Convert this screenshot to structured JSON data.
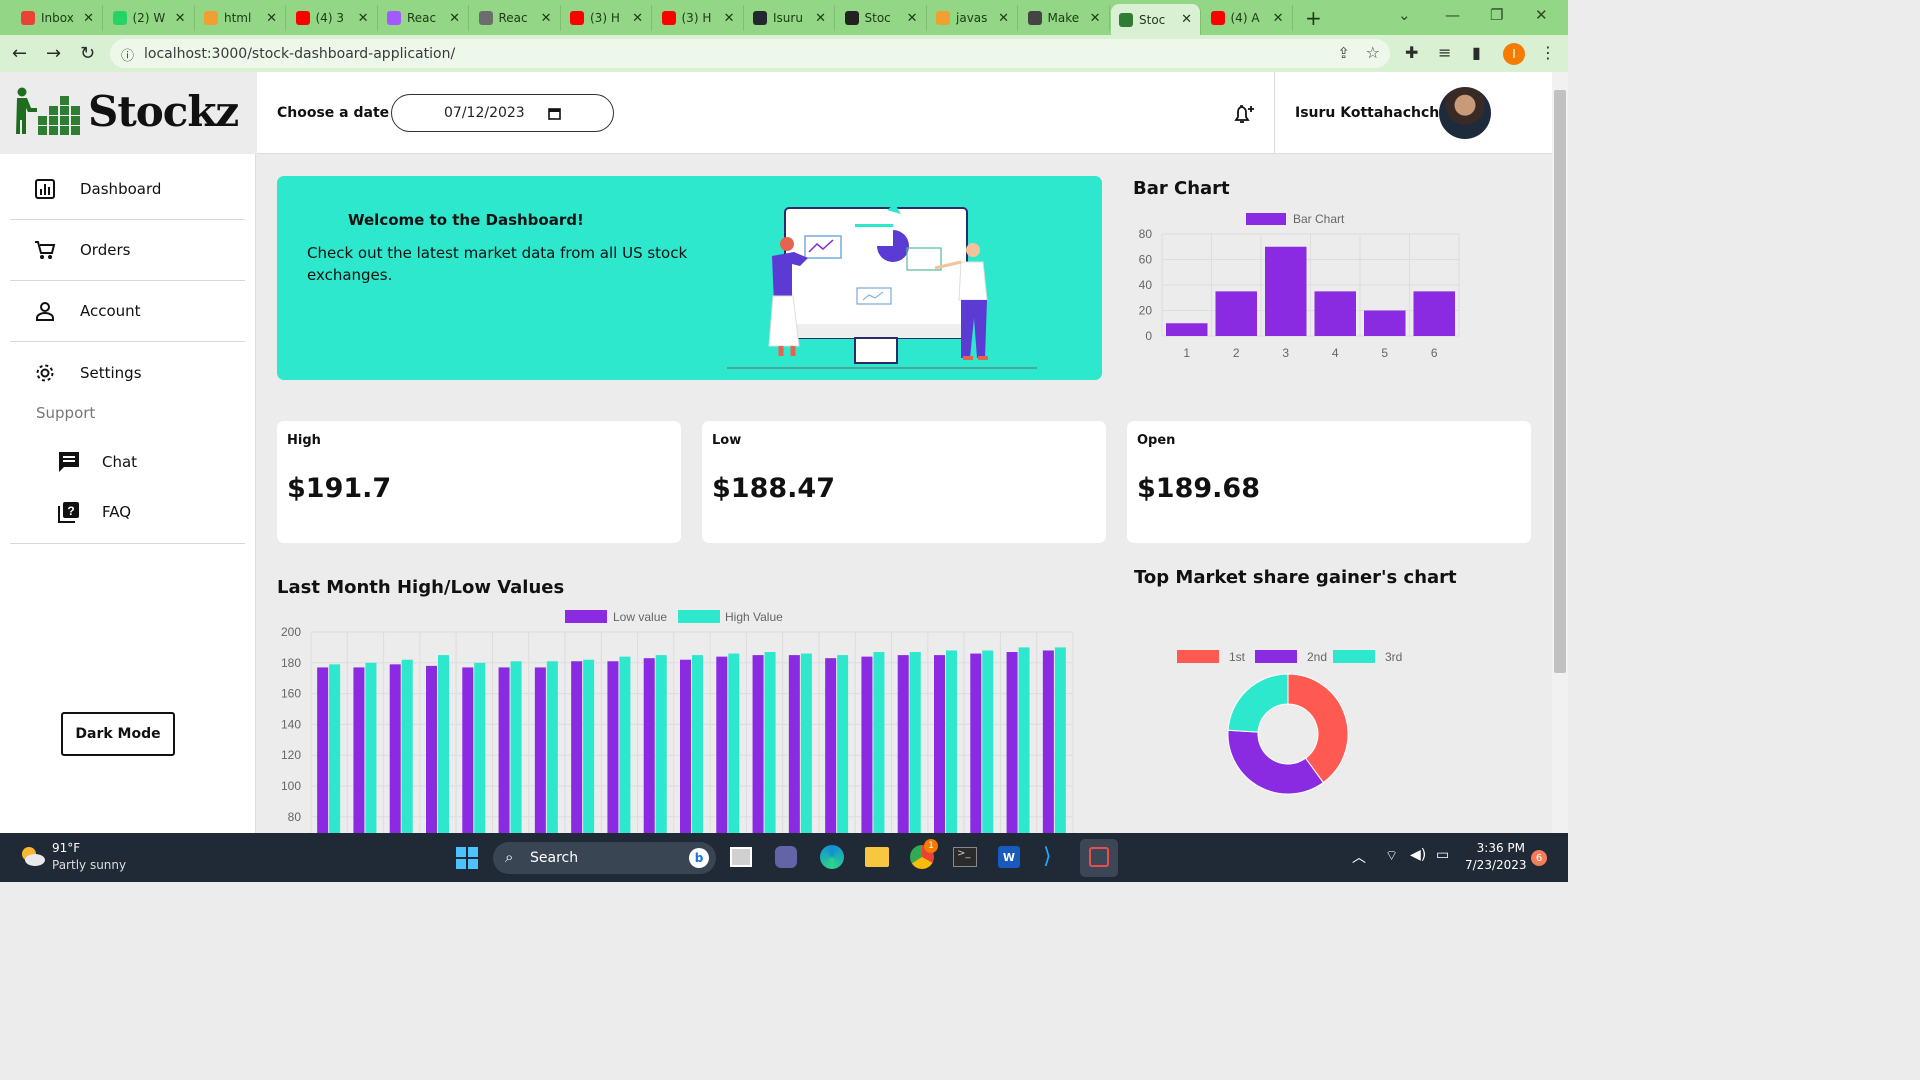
{
  "browser": {
    "tabs": [
      {
        "title": "Inbox",
        "color": "#ea4335"
      },
      {
        "title": "(2) W",
        "color": "#25d366"
      },
      {
        "title": "html",
        "color": "#f0a030"
      },
      {
        "title": "(4) 3",
        "color": "#ff0000"
      },
      {
        "title": "Reac",
        "color": "#a259ff"
      },
      {
        "title": "Reac",
        "color": "#6d6d6d"
      },
      {
        "title": "(3) H",
        "color": "#ff0000"
      },
      {
        "title": "(3) H",
        "color": "#ff0000"
      },
      {
        "title": "Isuru",
        "color": "#24292e"
      },
      {
        "title": "Stoc",
        "color": "#222222"
      },
      {
        "title": "javas",
        "color": "#f0a030"
      },
      {
        "title": "Make",
        "color": "#444444"
      },
      {
        "title": "Stoc",
        "color": "#2e7d32"
      },
      {
        "title": "(4) A",
        "color": "#ff0000"
      }
    ],
    "active_tab_index": 12,
    "url": "localhost:3000/stock-dashboard-application/"
  },
  "app": {
    "brand": "Stockz",
    "nav": [
      {
        "label": "Dashboard",
        "icon": "chart-icon"
      },
      {
        "label": "Orders",
        "icon": "cart-icon"
      },
      {
        "label": "Account",
        "icon": "user-icon"
      },
      {
        "label": "Settings",
        "icon": "gear-icon"
      }
    ],
    "support_label": "Support",
    "support_items": [
      {
        "label": "Chat",
        "icon": "chat-icon"
      },
      {
        "label": "FAQ",
        "icon": "faq-icon"
      }
    ],
    "dark_mode_label": "Dark Mode",
    "date_label": "Choose a date",
    "date_value": "07/12/2023",
    "user_name": "Isuru Kottahachchi",
    "banner": {
      "title": "Welcome to the Dashboard!",
      "subtitle": "Check out the latest market data from all US stock exchanges."
    },
    "cards": [
      {
        "label": "High",
        "value": "$191.7"
      },
      {
        "label": "Low",
        "value": "$188.47"
      },
      {
        "label": "Open",
        "value": "$189.68"
      }
    ],
    "bar_chart_title": "Bar Chart",
    "hl_chart_title": "Last Month High/Low Values",
    "donut_title": "Top Market share gainer's chart"
  },
  "colors": {
    "accent": "#8a2be2",
    "teal": "#2ee8ce",
    "coral": "#ff5a52"
  },
  "chart_data": [
    {
      "type": "bar",
      "title": "Bar Chart",
      "categories": [
        "1",
        "2",
        "3",
        "4",
        "5",
        "6"
      ],
      "series": [
        {
          "name": "Bar Chart",
          "values": [
            10,
            35,
            70,
            35,
            20,
            35
          ]
        }
      ],
      "ylim": [
        0,
        80
      ],
      "yticks": [
        0,
        20,
        40,
        60,
        80
      ],
      "legend": "top",
      "grid": true
    },
    {
      "type": "bar",
      "title": "Last Month High/Low Values",
      "categories": [
        "",
        "",
        "",
        "",
        "",
        "",
        "",
        "",
        "",
        "",
        "",
        "",
        "",
        "",
        "",
        "",
        "",
        "",
        "",
        "",
        ""
      ],
      "series": [
        {
          "name": "Low value",
          "values": [
            177,
            177,
            179,
            178,
            177,
            177,
            177,
            181,
            181,
            183,
            182,
            184,
            185,
            185,
            183,
            184,
            185,
            185,
            186,
            187,
            188
          ]
        },
        {
          "name": "High Value",
          "values": [
            179,
            180,
            182,
            185,
            180,
            181,
            181,
            182,
            184,
            185,
            185,
            186,
            187,
            186,
            185,
            187,
            187,
            188,
            188,
            190,
            190
          ]
        }
      ],
      "yticks": [
        80,
        100,
        120,
        140,
        160,
        180,
        200
      ],
      "ylim": [
        80,
        200
      ],
      "legend": "top",
      "grid": true
    },
    {
      "type": "pie",
      "title": "Top Market share gainer's chart",
      "labels": [
        "1st",
        "2nd",
        "3rd"
      ],
      "values": [
        40,
        36,
        24
      ],
      "legend": "top",
      "donut": true
    }
  ],
  "taskbar": {
    "weather_temp": "91°F",
    "weather_desc": "Partly sunny",
    "search_label": "Search",
    "time": "3:36 PM",
    "date": "7/23/2023",
    "notif_count": "6",
    "chrome_badge": "1"
  }
}
